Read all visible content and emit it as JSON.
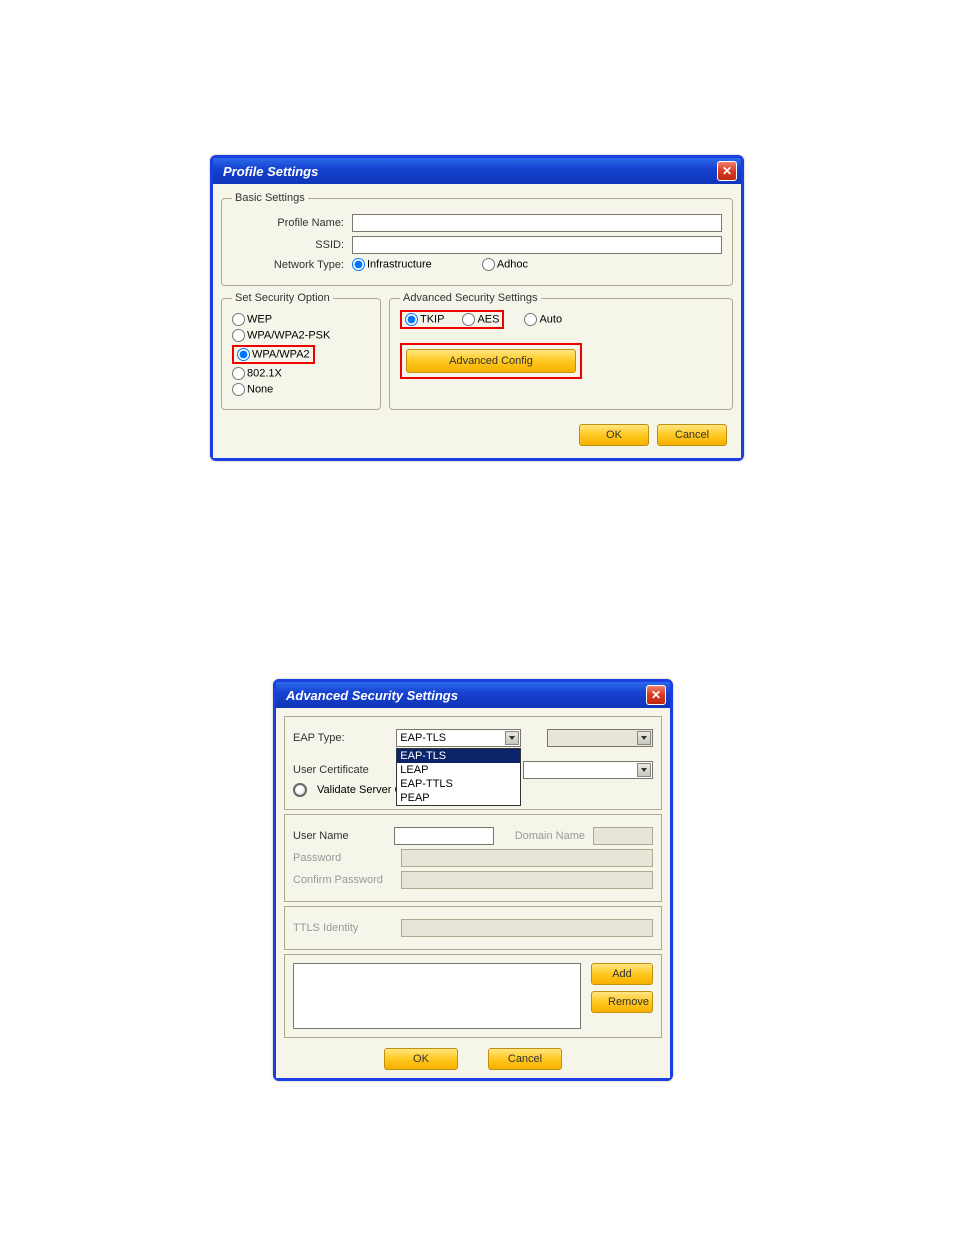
{
  "dialog1": {
    "title": "Profile Settings",
    "basic": {
      "legend": "Basic Settings",
      "profile_label": "Profile Name:",
      "profile_value": "",
      "ssid_label": "SSID:",
      "ssid_value": "",
      "nettype_label": "Network Type:",
      "infra": "Infrastructure",
      "adhoc": "Adhoc"
    },
    "security": {
      "legend": "Set Security Option",
      "wep": "WEP",
      "wpapsk": "WPA/WPA2-PSK",
      "wpa": "WPA/WPA2",
      "dot1x": "802.1X",
      "none": "None"
    },
    "advanced": {
      "legend": "Advanced Security Settings",
      "tkip": "TKIP",
      "aes": "AES",
      "auto": "Auto",
      "config_btn": "Advanced Config"
    },
    "ok": "OK",
    "cancel": "Cancel"
  },
  "dialog2": {
    "title": "Advanced Security Settings",
    "eap_label": "EAP Type:",
    "eap_value": "EAP-TLS",
    "eap_options": [
      "EAP-TLS",
      "LEAP",
      "EAP-TTLS",
      "PEAP"
    ],
    "usercert_label": "User Certificate",
    "validate_label": "Validate Server Certificate",
    "username_label": "User Name",
    "domain_label": "Domain Name",
    "password_label": "Password",
    "confirm_label": "Confirm Password",
    "ttls_label": "TTLS Identity",
    "add": "Add",
    "remove": "Remove",
    "ok": "OK",
    "cancel": "Cancel"
  }
}
